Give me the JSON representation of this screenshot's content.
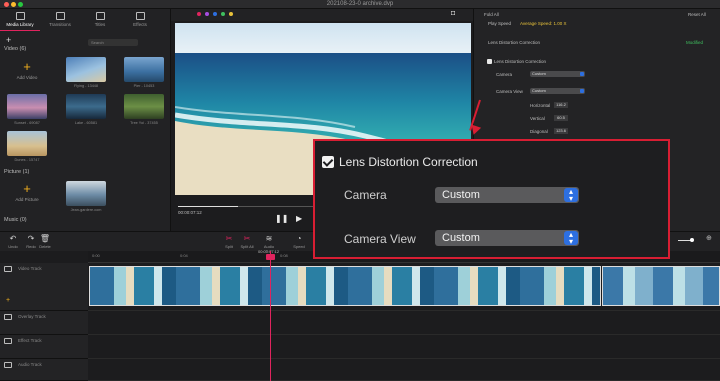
{
  "window": {
    "title": "202108-23-0 archive.dvp"
  },
  "left_panel": {
    "tabs": [
      {
        "label": "Media Library",
        "icon": "media-library-icon"
      },
      {
        "label": "Transitions",
        "icon": "transitions-icon"
      },
      {
        "label": "Titles",
        "icon": "titles-icon"
      },
      {
        "label": "Effects",
        "icon": "effects-icon"
      }
    ],
    "search_placeholder": "Search",
    "video_section": "Video (6)",
    "add_video": "Add Video",
    "videos": [
      "Flying - 13448",
      "Pier - 10453",
      "Sunset - 69087",
      "Lake - 60581",
      "Tree Yoi - 37455",
      "Dunes - 15747"
    ],
    "picture_section": "Picture (1)",
    "add_picture": "Add Picture",
    "pictures": [
      "Jean-gardere.com"
    ],
    "music_section": "Music (0)"
  },
  "preview": {
    "timecode": "00:00:07:12"
  },
  "right_panel": {
    "fold_all": "Fold All",
    "reset_all": "Reset All",
    "play_speed_label": "Play Speed",
    "play_speed_value": "Average Speed: 1.00 X",
    "section_title": "Lens Distortion Correction",
    "modified": "Modified",
    "checkbox_label": "Lens Distortion Correction",
    "camera_label": "Camera",
    "camera_value": "Custom",
    "camera_view_label": "Camera View",
    "camera_view_value": "Custom",
    "horizontal_label": "Horizontal",
    "horizontal_value": "116.2",
    "vertical_label": "Vertical",
    "vertical_value": "60.5",
    "diagonal_label": "Diagonal",
    "diagonal_value": "123.6"
  },
  "zoom_overlay": {
    "title": "Lens Distortion Correction",
    "camera_label": "Camera",
    "camera_value": "Custom",
    "camera_view_label": "Camera View",
    "camera_view_value": "Custom"
  },
  "timeline": {
    "toolbar": [
      {
        "label": "Undo",
        "icon": "undo-icon"
      },
      {
        "label": "Redo",
        "icon": "redo-icon"
      },
      {
        "label": "Delete",
        "icon": "delete-icon"
      },
      {
        "label": "Split",
        "icon": "split-icon"
      },
      {
        "label": "Split All",
        "icon": "split-all-icon"
      },
      {
        "label": "Audio Edit",
        "icon": "audio-edit-icon"
      },
      {
        "label": "Speed",
        "icon": "speed-icon"
      }
    ],
    "playhead_timecode": "00:00:07:12",
    "ruler": [
      "0:00",
      "0:04",
      "0:08"
    ],
    "tracks": [
      "Video Track",
      "Overlay Track",
      "Effect Track",
      "Audio Track"
    ]
  },
  "colors": {
    "accent_red": "#d81e33",
    "brand_pink": "#e0245e",
    "select_blue": "#2d6fe0",
    "speed_yellow": "#e8c23a",
    "modified_green": "#3fbf5f"
  }
}
